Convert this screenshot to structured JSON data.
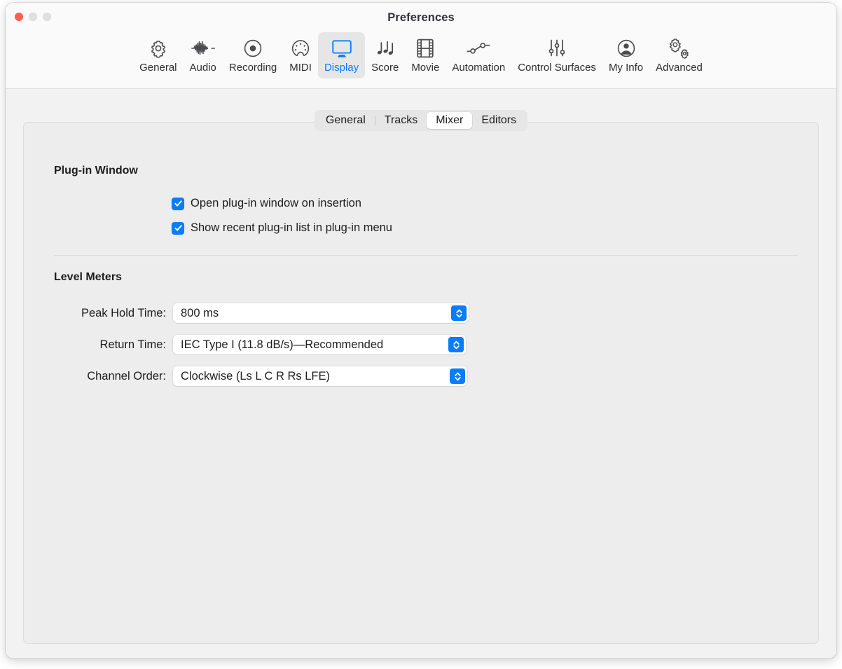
{
  "window": {
    "title": "Preferences",
    "traffic_lights": [
      {
        "name": "close-button",
        "color": "#ff6057"
      },
      {
        "name": "minimize-button",
        "color": "#e0e0e0"
      },
      {
        "name": "zoom-button",
        "color": "#e0e0e0"
      }
    ]
  },
  "toolbar": {
    "accent_color": "#0a7cff",
    "selected": "Display",
    "items": [
      {
        "label": "General",
        "icon": "gear-icon"
      },
      {
        "label": "Audio",
        "icon": "waveform-icon"
      },
      {
        "label": "Recording",
        "icon": "record-circle-icon"
      },
      {
        "label": "MIDI",
        "icon": "midi-din-icon"
      },
      {
        "label": "Display",
        "icon": "monitor-icon"
      },
      {
        "label": "Score",
        "icon": "music-notes-icon"
      },
      {
        "label": "Movie",
        "icon": "film-strip-icon"
      },
      {
        "label": "Automation",
        "icon": "automation-nodes-icon"
      },
      {
        "label": "Control Surfaces",
        "icon": "sliders-icon"
      },
      {
        "label": "My Info",
        "icon": "person-circle-icon"
      },
      {
        "label": "Advanced",
        "icon": "gears-icon"
      }
    ]
  },
  "tabs": {
    "selected": "Mixer",
    "items": [
      {
        "label": "General"
      },
      {
        "label": "Tracks"
      },
      {
        "label": "Mixer"
      },
      {
        "label": "Editors"
      }
    ]
  },
  "plugin_window": {
    "heading": "Plug-in Window",
    "checkboxes": [
      {
        "label": "Open plug-in window on insertion",
        "checked": true
      },
      {
        "label": "Show recent plug-in list in plug-in menu",
        "checked": true
      }
    ]
  },
  "level_meters": {
    "heading": "Level Meters",
    "fields": [
      {
        "label": "Peak Hold Time:",
        "value": "800 ms"
      },
      {
        "label": "Return Time:",
        "value": "IEC Type I (11.8 dB/s)—Recommended"
      },
      {
        "label": "Channel Order:",
        "value": "Clockwise (Ls L C R Rs LFE)"
      }
    ]
  }
}
